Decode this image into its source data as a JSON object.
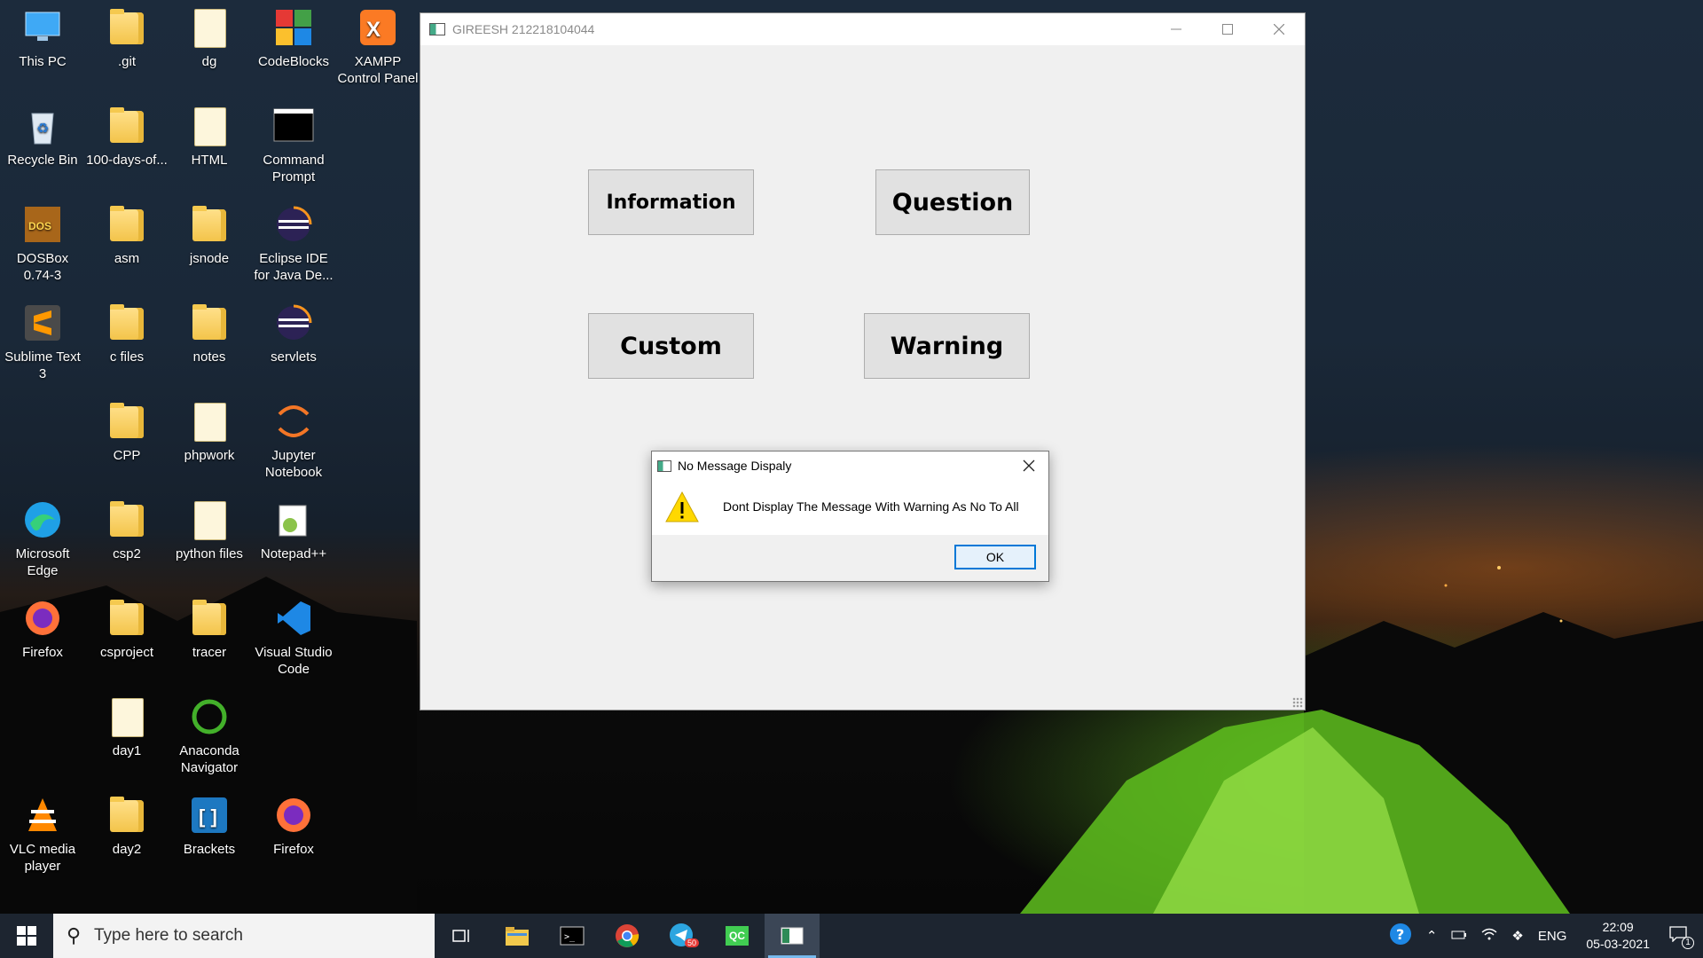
{
  "desktop": {
    "icons": [
      {
        "label": "This PC",
        "icon": "this-pc-icon"
      },
      {
        "label": ".git",
        "icon": "folder-icon"
      },
      {
        "label": "dg",
        "icon": "c-file-icon"
      },
      {
        "label": "CodeBlocks",
        "icon": "codeblocks-icon"
      },
      {
        "label": "XAMPP Control Panel",
        "icon": "xampp-icon"
      },
      {
        "label": "Recycle Bin",
        "icon": "recycle-bin-icon"
      },
      {
        "label": "100-days-of...",
        "icon": "folder-icon"
      },
      {
        "label": "HTML",
        "icon": "chrome-file-icon"
      },
      {
        "label": "Command Prompt",
        "icon": "command-prompt-icon"
      },
      {
        "label": "DOSBox 0.74-3",
        "icon": "dosbox-icon"
      },
      {
        "label": "asm",
        "icon": "folder-icon"
      },
      {
        "label": "jsnode",
        "icon": "folder-icon"
      },
      {
        "label": "Eclipse IDE for Java De...",
        "icon": "eclipse-icon"
      },
      {
        "label": "Sublime Text 3",
        "icon": "sublime-icon"
      },
      {
        "label": "c files",
        "icon": "folder-icon"
      },
      {
        "label": "notes",
        "icon": "folder-icon"
      },
      {
        "label": "servlets",
        "icon": "eclipse-icon"
      },
      {
        "label": "CPP",
        "icon": "folder-icon"
      },
      {
        "label": "phpwork",
        "icon": "file-icon"
      },
      {
        "label": "Jupyter Notebook",
        "icon": "jupyter-icon"
      },
      {
        "label": "Microsoft Edge",
        "icon": "edge-icon"
      },
      {
        "label": "csp2",
        "icon": "folder-icon"
      },
      {
        "label": "python files",
        "icon": "file-icon"
      },
      {
        "label": "Notepad++",
        "icon": "notepadpp-icon"
      },
      {
        "label": "Firefox",
        "icon": "firefox-icon"
      },
      {
        "label": "csproject",
        "icon": "folder-icon"
      },
      {
        "label": "tracer",
        "icon": "folder-icon"
      },
      {
        "label": "Visual Studio Code",
        "icon": "vscode-icon"
      },
      {
        "label": "day1",
        "icon": "chrome-file-icon"
      },
      {
        "label": "Anaconda Navigator",
        "icon": "anaconda-icon"
      },
      {
        "label": "VLC media player",
        "icon": "vlc-icon"
      },
      {
        "label": "day2",
        "icon": "folder-icon"
      },
      {
        "label": "Brackets",
        "icon": "brackets-icon"
      },
      {
        "label": "Firefox",
        "icon": "firefox-icon"
      }
    ]
  },
  "app_window": {
    "title": "GIREESH 212218104044",
    "buttons": {
      "information": "Information",
      "question": "Question",
      "custom": "Custom",
      "warning": "Warning"
    }
  },
  "dialog": {
    "title": "No Message Dispaly",
    "message": "Dont Display The Message With Warning As No To All",
    "ok_label": "OK",
    "icon": "warning-icon"
  },
  "taskbar": {
    "search_placeholder": "Type here to search",
    "telegram_badge": "50",
    "qt_label": "QC",
    "language": "ENG",
    "time": "22:09",
    "date": "05-03-2021",
    "notification_count": "1"
  },
  "colors": {
    "accent": "#0078d7",
    "taskbar": "#1d2530",
    "window_bg": "#f0f0f0"
  }
}
